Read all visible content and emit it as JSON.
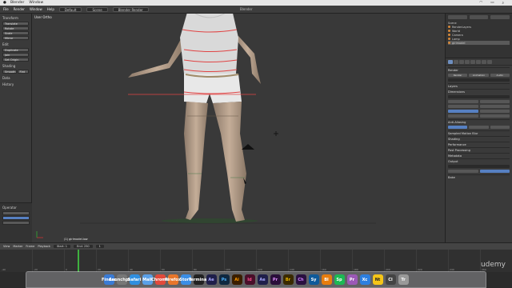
{
  "mac_menu": {
    "apple": "",
    "app": "Blender",
    "window": "Window"
  },
  "blender_header": {
    "title": "Blender",
    "menus": [
      "File",
      "Render",
      "Window",
      "Help"
    ],
    "layout_field": "Default",
    "scene_field": "Scene",
    "engine_field": "Blender Render"
  },
  "tool_shelf": {
    "sections": [
      "Transform",
      "Edit",
      "History"
    ],
    "buttons": [
      "Translate",
      "Rotate",
      "Scale",
      "Mirror",
      "Duplicate",
      "Join",
      "Set Origin",
      "Shading",
      "Smooth",
      "Flat",
      "Data"
    ],
    "operator_title": "Operator"
  },
  "viewport": {
    "label": "User Ortho",
    "object_label": "(1) girlmodel.low"
  },
  "outliner": {
    "items": [
      "Scene",
      "RenderLayers",
      "World",
      "Camera",
      "Lamp",
      "girlmodel"
    ]
  },
  "properties": {
    "sections": [
      "Render",
      "Layers",
      "Dimensions",
      "Anti-Aliasing",
      "Sampled Motion Blur",
      "Shading",
      "Performance",
      "Post Processing",
      "Metadata",
      "Output",
      "Bake"
    ],
    "render_button": "Render",
    "animation_button": "Animation",
    "audio_button": "Audio"
  },
  "timeline": {
    "menus": [
      "View",
      "Marker",
      "Frame",
      "Playback"
    ],
    "start_label": "Start: 1",
    "end_label": "End: 250",
    "frame": "1",
    "ticks": [
      "-40",
      "-20",
      "0",
      "20",
      "40",
      "60",
      "80",
      "100",
      "120",
      "140",
      "160",
      "180",
      "200",
      "220",
      "240",
      "260"
    ]
  },
  "dock": {
    "apps": [
      "Finder",
      "Launchpad",
      "Safari",
      "Mail",
      "Chrome",
      "Firefox",
      "Store",
      "Terminal",
      "Ae",
      "Ps",
      "Ai",
      "Id",
      "Ae",
      "Pr",
      "Br",
      "Ch",
      "Sy",
      "Bl",
      "Sp",
      "Pr",
      "Xc",
      "Nt",
      "Cl",
      "Tr"
    ]
  },
  "watermark": "udemy",
  "colors": {
    "accent": "#5680c2",
    "playhead": "#3fb13f",
    "active_object": "#d88a3a"
  }
}
